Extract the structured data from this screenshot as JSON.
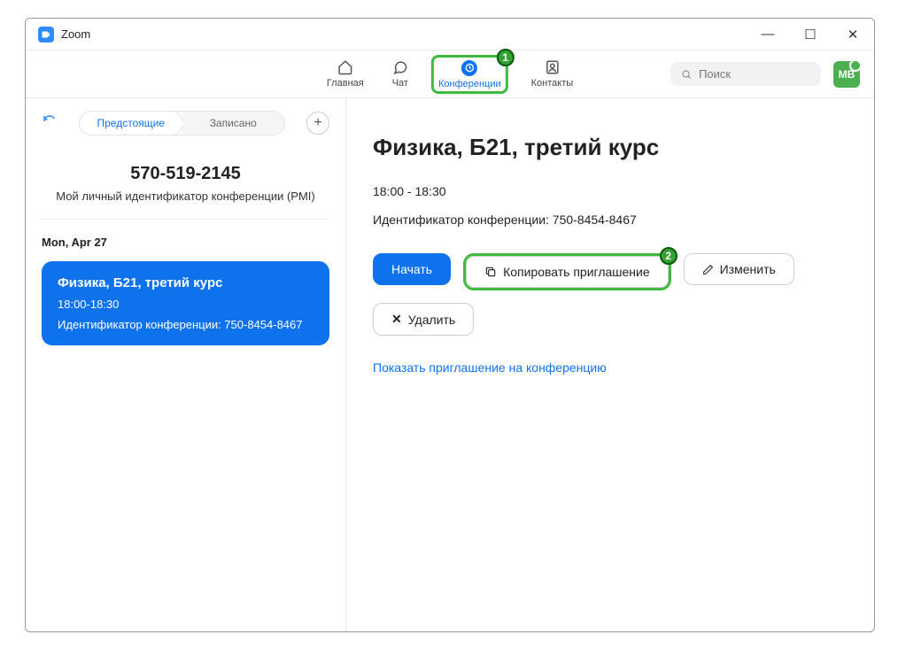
{
  "window": {
    "title": "Zoom"
  },
  "nav": {
    "home": "Главная",
    "chat": "Чат",
    "meetings": "Конференции",
    "contacts": "Контакты"
  },
  "search": {
    "placeholder": "Поиск"
  },
  "avatar": {
    "initials": "МВ"
  },
  "sidebar": {
    "tabs": {
      "upcoming": "Предстоящие",
      "recorded": "Записано"
    },
    "pmi": {
      "number": "570-519-2145",
      "label": "Мой личный идентификатор конференции (PMI)"
    },
    "date": "Mon, Apr 27",
    "card": {
      "title": "Физика, Б21, третий курс",
      "time": "18:00-18:30",
      "id_line": "Идентификатор конференции: 750-8454-8467"
    }
  },
  "main": {
    "title": "Физика, Б21, третий курс",
    "time": "18:00 - 18:30",
    "id_line": "Идентификатор конференции: 750-8454-8467",
    "buttons": {
      "start": "Начать",
      "copy": "Копировать приглашение",
      "edit": "Изменить",
      "delete": "Удалить"
    },
    "show_invite": "Показать приглашение на конференцию"
  },
  "annotations": {
    "badge1": "1",
    "badge2": "2"
  }
}
